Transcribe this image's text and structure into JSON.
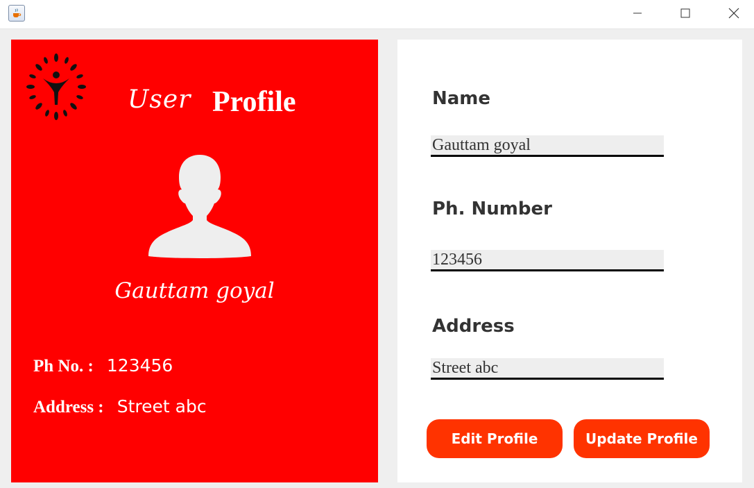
{
  "window": {
    "app_icon": "java-cup-icon",
    "controls": [
      "minimize-icon",
      "maximize-icon",
      "close-icon"
    ]
  },
  "card": {
    "background_color": "#ff0000",
    "logo_icon": "flower-person-logo",
    "title_script": "User",
    "title_bold": "Profile",
    "avatar_icon": "user-silhouette-icon",
    "name": "Gauttam goyal",
    "phone_label": "Ph No. :",
    "phone_value": "123456",
    "address_label": "Address :",
    "address_value": "Street abc"
  },
  "form": {
    "name_label": "Name",
    "name_value": "Gauttam goyal",
    "phone_label": "Ph. Number",
    "phone_value": "123456",
    "address_label": "Address",
    "address_value": "Street abc",
    "edit_button": "Edit Profile",
    "update_button": "Update Profile",
    "button_color": "#ff3300"
  }
}
